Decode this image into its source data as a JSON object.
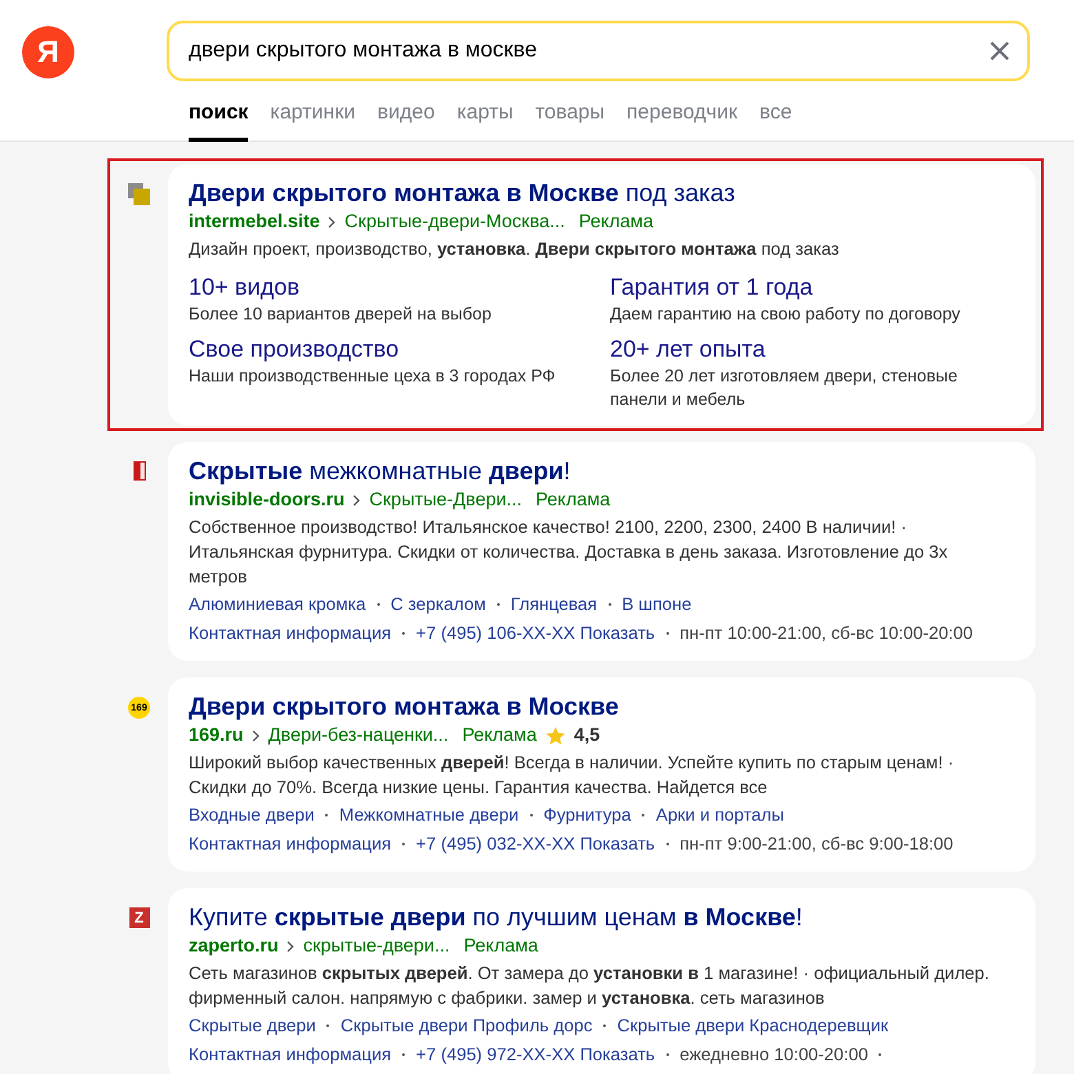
{
  "logo": {
    "letter": "Я"
  },
  "search": {
    "value": "двери скрытого монтажа в москве"
  },
  "tabs": [
    {
      "label": "поиск",
      "selected": true
    },
    {
      "label": "картинки",
      "selected": false
    },
    {
      "label": "видео",
      "selected": false
    },
    {
      "label": "карты",
      "selected": false
    },
    {
      "label": "товары",
      "selected": false
    },
    {
      "label": "переводчик",
      "selected": false
    },
    {
      "label": "все",
      "selected": false
    }
  ],
  "results": [
    {
      "highlighted": true,
      "favicon": {
        "kind": "squares"
      },
      "title": "**Двери скрытого монтажа в Москве** под заказ",
      "domain": "intermebel.site",
      "path": "Скрытые-двери-Москва...",
      "ad_label": "Реклама",
      "text": "Дизайн проект, производство, **установка**. **Двери скрытого монтажа** под заказ",
      "sitelinks": [
        {
          "title": "10+ видов",
          "text": "Более 10 вариантов дверей на выбор"
        },
        {
          "title": "Гарантия от 1 года",
          "text": "Даем гарантию на свою работу по договору"
        },
        {
          "title": "Свое производство",
          "text": "Наши производственные цеха в 3 городах РФ"
        },
        {
          "title": "20+ лет опыта",
          "text": "Более 20 лет изготовляем двери, стеновые панели и мебель"
        }
      ]
    },
    {
      "highlighted": false,
      "favicon": {
        "kind": "door"
      },
      "title": "**Скрытые** межкомнатные **двери**!",
      "domain": "invisible-doors.ru",
      "path": "Скрытые-Двери...",
      "ad_label": "Реклама",
      "text": "Собственное производство! Итальянское качество! 2100, 2200, 2300, 2400 В наличии! · Итальянская фурнитура. Скидки от количества. Доставка в день заказа. Изготовление до 3х метров",
      "quick_links": [
        "Алюминиевая кромка",
        "С зеркалом",
        "Глянцевая",
        "В шпоне"
      ],
      "contacts": [
        {
          "kind": "link",
          "text": "Контактная информация"
        },
        {
          "kind": "link",
          "text": "+7 (495) 106-XX-XX Показать"
        },
        {
          "kind": "text",
          "text": "пн-пт 10:00-21:00, сб-вс 10:00-20:00"
        }
      ]
    },
    {
      "highlighted": false,
      "favicon": {
        "kind": "circle",
        "text": "169"
      },
      "title": "**Двери скрытого монтажа в Москве**",
      "domain": "169.ru",
      "path": "Двери-без-наценки...",
      "ad_label": "Реклама",
      "rating": "4,5",
      "text": "Широкий выбор качественных **дверей**! Всегда в наличии. Успейте купить по старым ценам! · Скидки до 70%. Всегда низкие цены. Гарантия качества. Найдется все",
      "quick_links": [
        "Входные двери",
        "Межкомнатные двери",
        "Фурнитура",
        "Арки и порталы"
      ],
      "contacts": [
        {
          "kind": "link",
          "text": "Контактная информация"
        },
        {
          "kind": "link",
          "text": "+7 (495) 032-XX-XX Показать"
        },
        {
          "kind": "text",
          "text": "пн-пт 9:00-21:00, сб-вс 9:00-18:00"
        }
      ]
    },
    {
      "highlighted": false,
      "favicon": {
        "kind": "square",
        "text": "Z"
      },
      "title": "Купите **скрытые двери** по лучшим ценам **в Москве**!",
      "domain": "zaperto.ru",
      "path": "скрытые-двери...",
      "ad_label": "Реклама",
      "text": "Сеть магазинов **скрытых дверей**. От замера до **установки в** 1 магазине! · официальный дилер. фирменный салон. напрямую с фабрики. замер и **установка**. сеть магазинов",
      "quick_links": [
        "Скрытые двери",
        "Скрытые двери Профиль дорс",
        "Скрытые двери Краснодеревщик"
      ],
      "contacts": [
        {
          "kind": "link",
          "text": "Контактная информация"
        },
        {
          "kind": "link",
          "text": "+7 (495) 972-XX-XX Показать"
        },
        {
          "kind": "text",
          "text": "ежедневно 10:00-20:00"
        }
      ],
      "continues": true
    }
  ]
}
